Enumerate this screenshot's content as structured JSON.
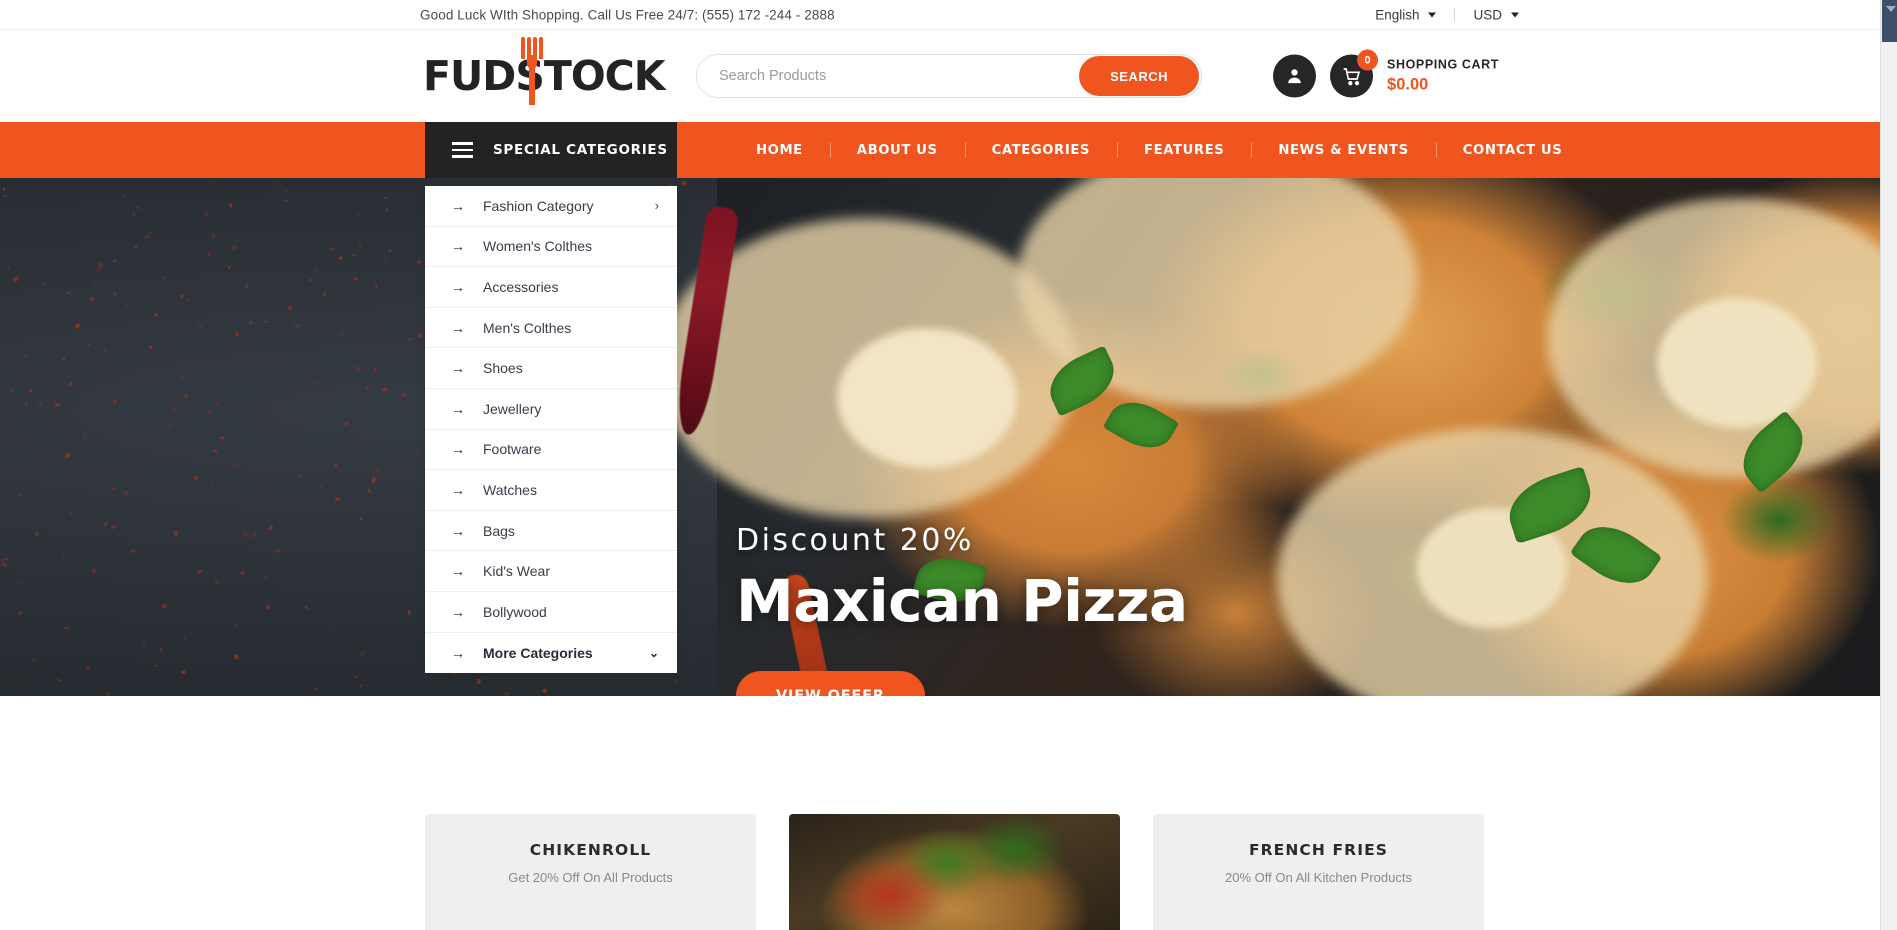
{
  "topbar": {
    "message": "Good Luck WIth Shopping. Call Us Free 24/7: (555) 172 -244 - 2888",
    "language": "English",
    "currency": "USD"
  },
  "header": {
    "logo_text": "FUDSTOCK",
    "search": {
      "placeholder": "Search Products",
      "value": "",
      "button_label": "SEARCH"
    },
    "account_icon": "user-icon",
    "cart": {
      "icon": "cart-icon",
      "badge": "0",
      "label": "SHOPPING CART",
      "total": "$0.00"
    }
  },
  "nav": {
    "categories_button": "SPECIAL CATEGORIES",
    "items": [
      {
        "label": "HOME"
      },
      {
        "label": "ABOUT US"
      },
      {
        "label": "CATEGORIES"
      },
      {
        "label": "FEATURES"
      },
      {
        "label": "NEWS & EVENTS"
      },
      {
        "label": "CONTACT US"
      }
    ]
  },
  "categories": {
    "items": [
      {
        "label": "Fashion Category",
        "chevron": "right",
        "bold": false
      },
      {
        "label": "Women's Colthes",
        "chevron": "",
        "bold": false
      },
      {
        "label": "Accessories",
        "chevron": "",
        "bold": false
      },
      {
        "label": "Men's Colthes",
        "chevron": "",
        "bold": false
      },
      {
        "label": "Shoes",
        "chevron": "",
        "bold": false
      },
      {
        "label": "Jewellery",
        "chevron": "",
        "bold": false
      },
      {
        "label": "Footware",
        "chevron": "",
        "bold": false
      },
      {
        "label": "Watches",
        "chevron": "",
        "bold": false
      },
      {
        "label": "Bags",
        "chevron": "",
        "bold": false
      },
      {
        "label": "Kid's Wear",
        "chevron": "",
        "bold": false
      },
      {
        "label": "Bollywood",
        "chevron": "",
        "bold": false
      },
      {
        "label": "More Categories",
        "chevron": "down",
        "bold": true
      }
    ]
  },
  "hero": {
    "subtitle": "Discount 20%",
    "title": "Maxican Pizza",
    "button_label": "VIEW OFFER"
  },
  "promos": [
    {
      "title": "CHIKENROLL",
      "subtitle": "Get 20% Off On All Products",
      "image": false
    },
    {
      "title": "",
      "subtitle": "",
      "image": true
    },
    {
      "title": "FRENCH FRIES",
      "subtitle": "20% Off On All Kitchen Products",
      "image": false
    }
  ],
  "colors": {
    "accent": "#f0541f",
    "dark": "#232323",
    "text": "#3b3b4a"
  }
}
